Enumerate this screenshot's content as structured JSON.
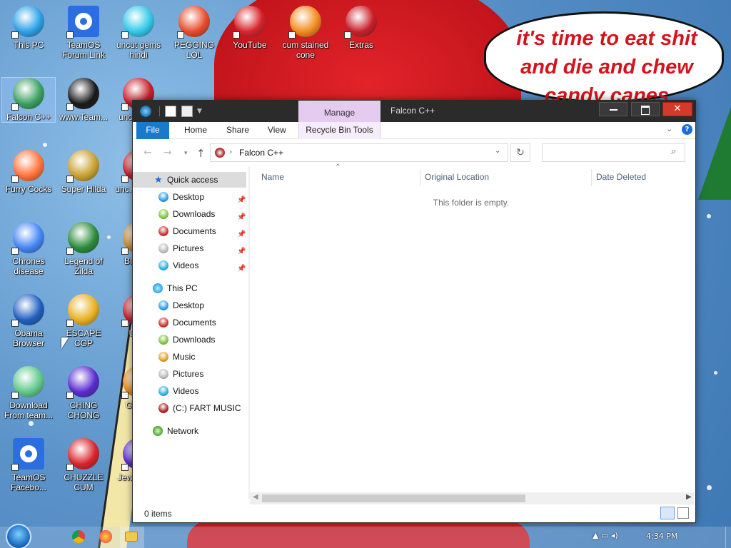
{
  "desktop": {
    "speech_bubble": "it's time to eat shit and die and chew candy canes",
    "icons": [
      {
        "label": "This PC",
        "icon": "computer-icon",
        "color": "#2aa0e8"
      },
      {
        "label": "TeamOS Forum Link",
        "icon": "gear-icon",
        "color": "#2a6ee0"
      },
      {
        "label": "uncut gems hindi",
        "icon": "diamond-icon",
        "color": "#30c8e8"
      },
      {
        "label": "PEGGING LOL",
        "icon": "p-logo-icon",
        "color": "#e84a2a"
      },
      {
        "label": "YouTube",
        "icon": "angry-bird-icon",
        "color": "#d8232a"
      },
      {
        "label": "cum stained cone",
        "icon": "traffic-cone-icon",
        "color": "#f28a1e"
      },
      {
        "label": "Extras",
        "icon": "red-book-icon",
        "color": "#c81e2a"
      },
      {
        "label": "Falcon C++",
        "icon": "recycle-bin-icon",
        "color": "#3aa060"
      },
      {
        "label": "www.Team...",
        "icon": "black-book-icon",
        "color": "#1a1a1a"
      },
      {
        "label": "uncu... b...",
        "icon": "red-heart-icon",
        "color": "#c81e2a"
      },
      {
        "label": "Furry Cocks",
        "icon": "firefox-icon",
        "color": "#ff7139"
      },
      {
        "label": "Super Hilda",
        "icon": "pixel-dog-icon",
        "color": "#c8a030"
      },
      {
        "label": "unc... dele...",
        "icon": "red-orb-icon",
        "color": "#c81e2a"
      },
      {
        "label": "Chrones disease",
        "icon": "chrome-icon",
        "color": "#4285f4"
      },
      {
        "label": "Legend of Zilda",
        "icon": "link-sprite-icon",
        "color": "#2a8a3a"
      },
      {
        "label": "BIIIIC...",
        "icon": "orb-icon",
        "color": "#c88a30"
      },
      {
        "label": "Obama Browser",
        "icon": "obama-logo-icon",
        "color": "#1f5fbf"
      },
      {
        "label": "ESCAPE CGP",
        "icon": "yellow-box-icon",
        "color": "#e8b020"
      },
      {
        "label": "UK...",
        "icon": "red-orb-icon",
        "color": "#c81e2a"
      },
      {
        "label": "Download From team...",
        "icon": "notepad-icon",
        "color": "#5fc88a"
      },
      {
        "label": "CHING CHONG",
        "icon": "purple-orb-icon",
        "color": "#5a2ad0"
      },
      {
        "label": "GEN...",
        "icon": "orange-box-icon",
        "color": "#e88a20"
      },
      {
        "label": "TeamOS Facebo...",
        "icon": "gear-icon",
        "color": "#2a6ee0"
      },
      {
        "label": "CHUZZLE CUM",
        "icon": "red-fuzzball-icon",
        "color": "#d8232a"
      },
      {
        "label": "Jew... Pa...",
        "icon": "purple-orb-icon",
        "color": "#5a2ad0"
      }
    ]
  },
  "window": {
    "title": "Falcon C++",
    "contextual_tab": "Manage",
    "ribbon_tabs": [
      "File",
      "Home",
      "Share",
      "View",
      "Recycle Bin Tools"
    ],
    "address": {
      "location": "Falcon C++"
    },
    "search": {
      "placeholder": ""
    },
    "nav": {
      "quick_access": "Quick access",
      "quick_items": [
        "Desktop",
        "Downloads",
        "Documents",
        "Pictures",
        "Videos"
      ],
      "this_pc": "This PC",
      "pc_items": [
        "Desktop",
        "Documents",
        "Downloads",
        "Music",
        "Pictures",
        "Videos",
        "(C:) FART MUSIC"
      ],
      "network": "Network"
    },
    "columns": [
      "Name",
      "Original Location",
      "Date Deleted"
    ],
    "empty_message": "This folder is empty.",
    "status": "0 items"
  },
  "taskbar": {
    "pinned": [
      "chrome-icon",
      "firefox-icon",
      "file-explorer-icon"
    ],
    "tray_time": "4:34 PM"
  },
  "colors": {
    "accent": "#1979ca",
    "titlebar": "#2b2b2b",
    "manage_tab": "#e3ccf0",
    "close_button": "#d43a2c",
    "bubble_text": "#d4141c"
  }
}
